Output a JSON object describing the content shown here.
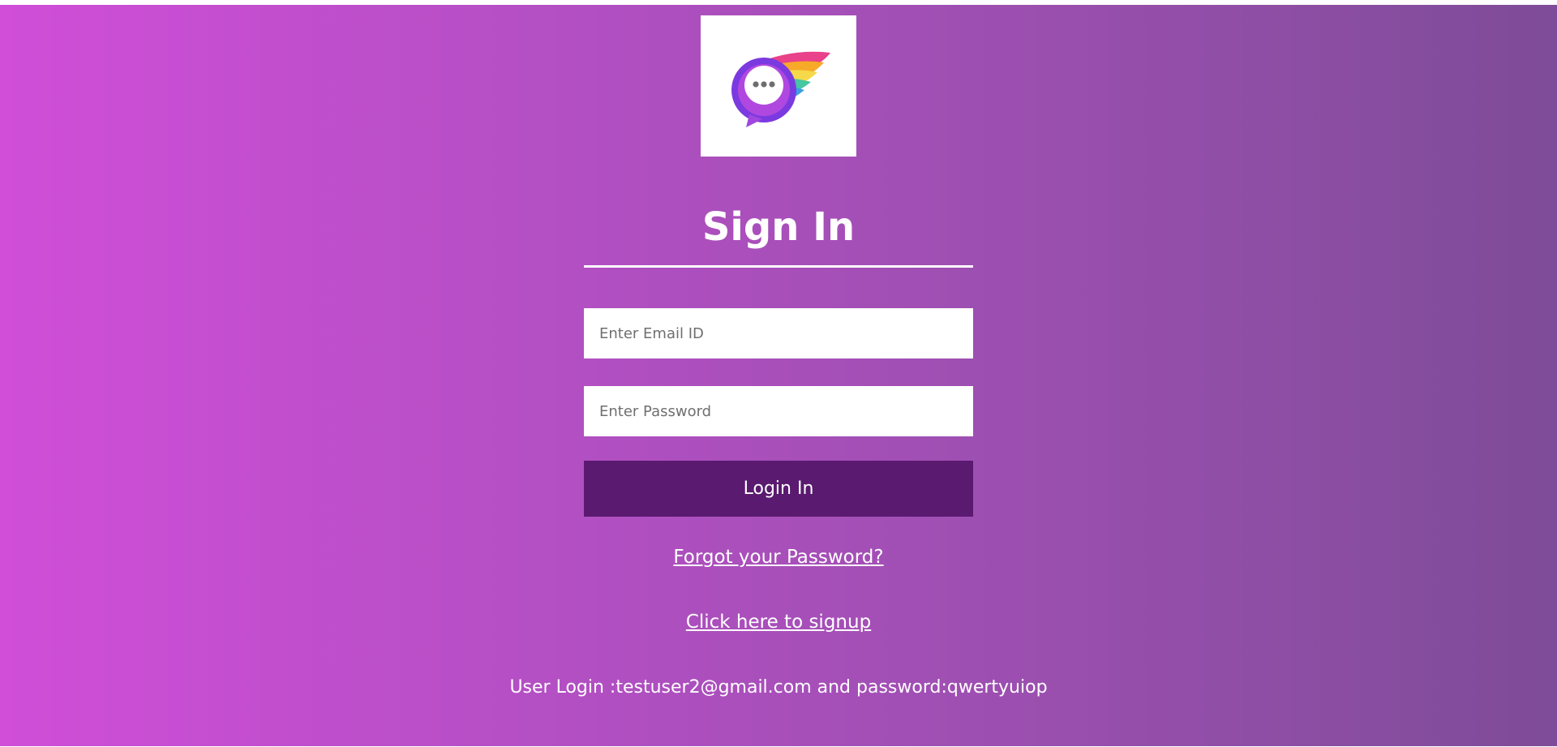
{
  "header": {
    "logo_icon": "chat-bubble-wing-logo-icon"
  },
  "form": {
    "title": "Sign In",
    "email_placeholder": "Enter Email ID",
    "email_value": "",
    "password_placeholder": "Enter Password",
    "password_value": "",
    "login_label": "Login In"
  },
  "links": {
    "forgot": "Forgot your Password?",
    "signup": "Click here to signup"
  },
  "footer": {
    "info": "User Login :testuser2@gmail.com and password:qwertyuiop"
  },
  "colors": {
    "gradient_start": "#d04ed8",
    "gradient_end": "#7e4c98",
    "button": "#5a1a70",
    "text": "#ffffff"
  }
}
